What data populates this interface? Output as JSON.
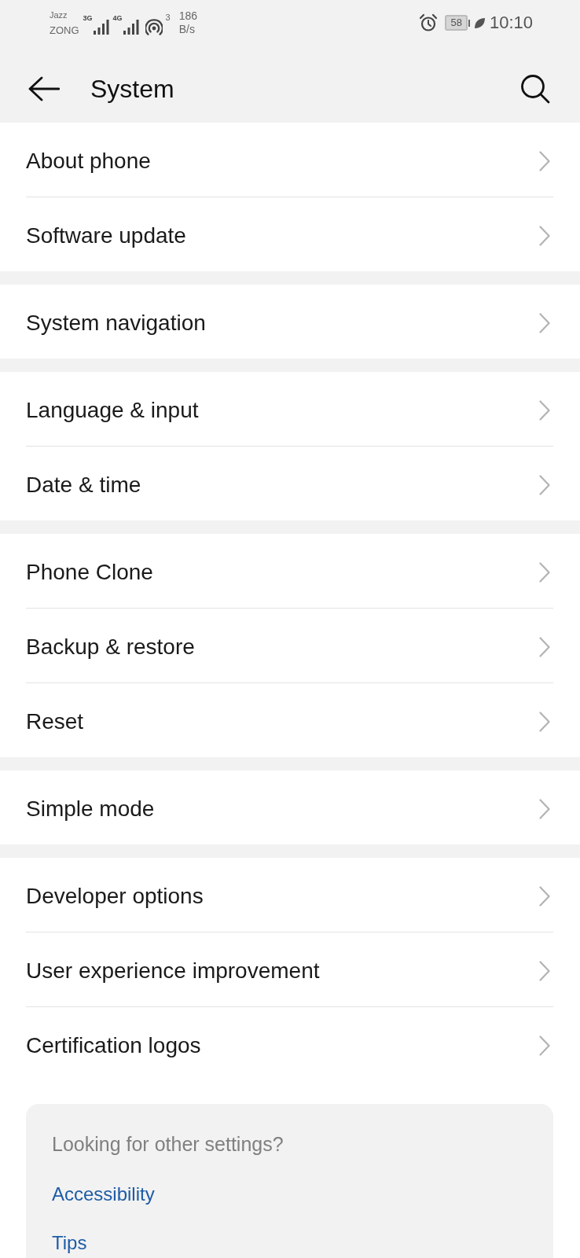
{
  "status_bar": {
    "carriers": [
      "Jazz",
      "ZONG"
    ],
    "networks": [
      "3G",
      "4G"
    ],
    "hotspot_clients": "3",
    "data_speed": [
      "186",
      "B/s"
    ],
    "battery": "58",
    "time": "10:10"
  },
  "header": {
    "title": "System"
  },
  "groups": [
    [
      "About phone",
      "Software update"
    ],
    [
      "System navigation"
    ],
    [
      "Language & input",
      "Date & time"
    ],
    [
      "Phone Clone",
      "Backup & restore",
      "Reset"
    ],
    [
      "Simple mode"
    ],
    [
      "Developer options",
      "User experience improvement",
      "Certification logos"
    ]
  ],
  "other_settings": {
    "heading": "Looking for other settings?",
    "links": [
      "Accessibility",
      "Tips"
    ]
  }
}
